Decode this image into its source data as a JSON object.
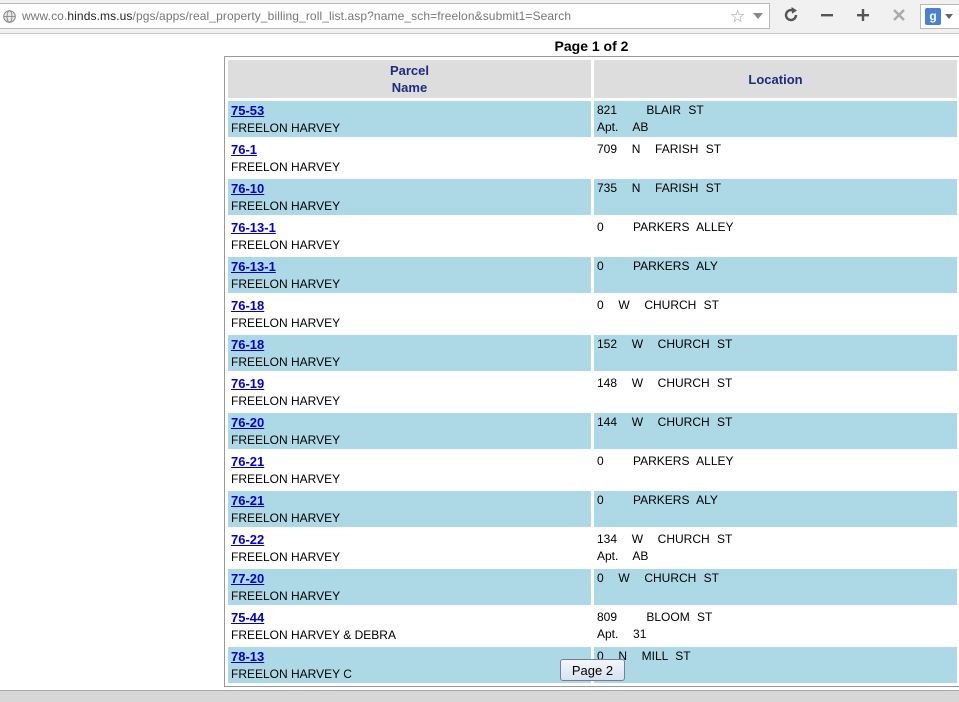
{
  "browser": {
    "url_prefix": "www.co.",
    "url_domain": "hinds.ms.us",
    "url_path": "/pgs/apps/real_property_billing_roll_list.asp?name_sch=freelon&submit1=Search"
  },
  "page": {
    "title": "Page 1 of 2",
    "next_button": "Page 2"
  },
  "table": {
    "headers": {
      "parcel_line1": "Parcel",
      "parcel_line2": "Name",
      "location": "Location"
    },
    "rows": [
      {
        "parcel": "75-53",
        "name": "FREELON HARVEY",
        "loc1": "821    BLAIR ST",
        "loc2": "Apt.  AB"
      },
      {
        "parcel": "76-1",
        "name": "FREELON HARVEY",
        "loc1": "709  N  FARISH ST",
        "loc2": ""
      },
      {
        "parcel": "76-10",
        "name": "FREELON HARVEY",
        "loc1": "735  N  FARISH ST",
        "loc2": ""
      },
      {
        "parcel": "76-13-1",
        "name": "FREELON HARVEY",
        "loc1": "0    PARKERS ALLEY",
        "loc2": ""
      },
      {
        "parcel": "76-13-1",
        "name": "FREELON HARVEY",
        "loc1": "0    PARKERS ALY",
        "loc2": ""
      },
      {
        "parcel": "76-18",
        "name": "FREELON HARVEY",
        "loc1": "0  W  CHURCH ST",
        "loc2": ""
      },
      {
        "parcel": "76-18",
        "name": "FREELON HARVEY",
        "loc1": "152  W  CHURCH ST",
        "loc2": ""
      },
      {
        "parcel": "76-19",
        "name": "FREELON HARVEY",
        "loc1": "148  W  CHURCH ST",
        "loc2": ""
      },
      {
        "parcel": "76-20",
        "name": "FREELON HARVEY",
        "loc1": "144  W  CHURCH ST",
        "loc2": ""
      },
      {
        "parcel": "76-21",
        "name": "FREELON HARVEY",
        "loc1": "0    PARKERS ALLEY",
        "loc2": ""
      },
      {
        "parcel": "76-21",
        "name": "FREELON HARVEY",
        "loc1": "0    PARKERS ALY",
        "loc2": ""
      },
      {
        "parcel": "76-22",
        "name": "FREELON HARVEY",
        "loc1": "134  W  CHURCH ST",
        "loc2": "Apt.  AB"
      },
      {
        "parcel": "77-20",
        "name": "FREELON HARVEY",
        "loc1": "0  W  CHURCH ST",
        "loc2": ""
      },
      {
        "parcel": "75-44",
        "name": "FREELON HARVEY & DEBRA",
        "loc1": "809    BLOOM ST",
        "loc2": "Apt.  31"
      },
      {
        "parcel": "78-13",
        "name": "FREELON HARVEY C",
        "loc1": "0  N  MILL ST",
        "loc2": ""
      }
    ]
  },
  "colors": {
    "row_alt": "#add8e6",
    "header_bg": "#dddddd",
    "header_text": "#1a2d80",
    "link": "#0000cc"
  },
  "icons": [
    "globe-icon",
    "bookmark-star-icon",
    "reload-icon",
    "minimize-icon",
    "add-icon",
    "close-icon",
    "google-search-icon"
  ]
}
